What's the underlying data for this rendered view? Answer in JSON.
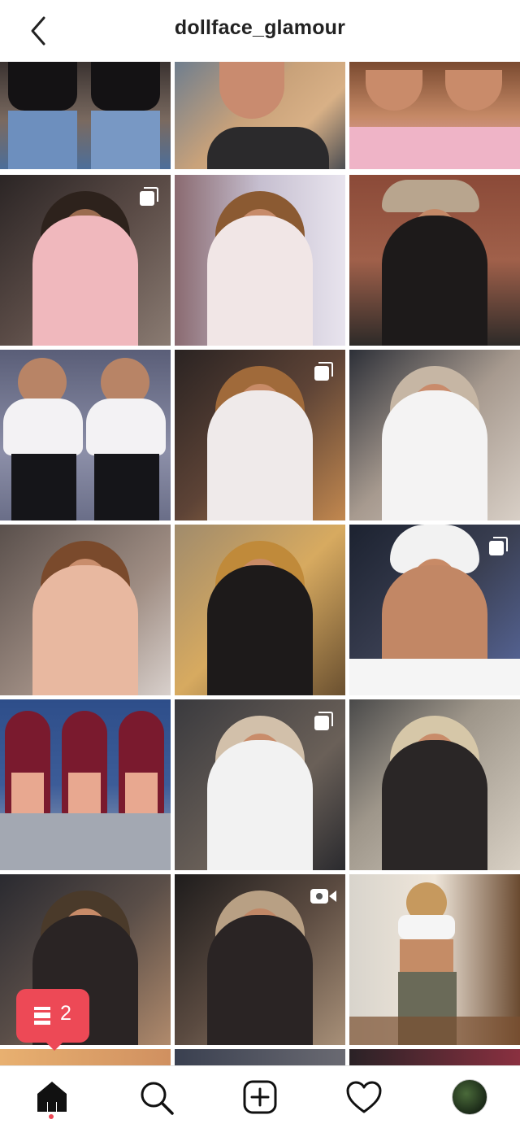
{
  "header": {
    "username": "dollface_glamour"
  },
  "icons": {
    "back": "chevron-left-icon",
    "multi_post": "carousel-icon",
    "video": "video-icon",
    "home": "home-icon",
    "search": "search-icon",
    "new_post": "add-post-icon",
    "activity": "heart-icon",
    "profile": "avatar"
  },
  "notification": {
    "count": "2"
  },
  "colors": {
    "accent": "#ed4956",
    "text": "#222222"
  }
}
